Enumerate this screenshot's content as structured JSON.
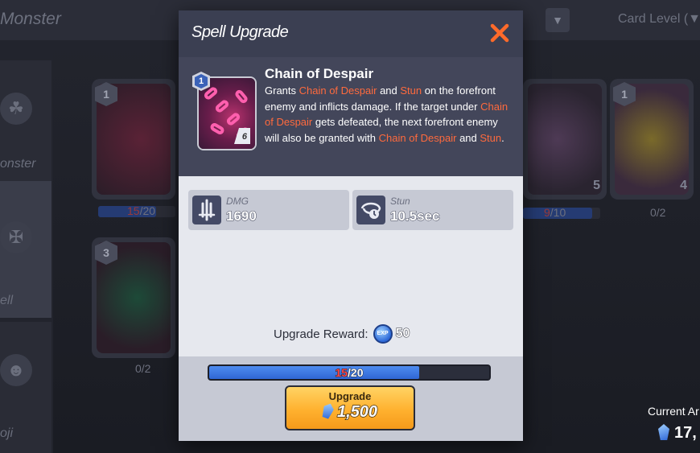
{
  "background": {
    "page_title": "Monster",
    "sort_label": "Card Level (▼",
    "sidebar_tabs": [
      {
        "label": "onster",
        "icon": "monster-icon"
      },
      {
        "label": "ell",
        "icon": "spell-icon"
      },
      {
        "label": "oji",
        "icon": "emoji-icon"
      }
    ],
    "cards": [
      {
        "level": "1",
        "grade": ""
      },
      {
        "level": "3",
        "grade": ""
      },
      {
        "level": "",
        "grade": "5"
      },
      {
        "level": "1",
        "grade": "4"
      }
    ],
    "progress_labels": [
      {
        "current": "15",
        "max": "/20"
      },
      {
        "current": "",
        "max": "0/2"
      },
      {
        "current": "9",
        "max": "/10"
      },
      {
        "current": "",
        "max": "0/2"
      }
    ],
    "currency_label": "Current Ar",
    "currency_amount": "17,"
  },
  "modal": {
    "title": "Spell Upgrade",
    "close_icon": "close-icon",
    "spell": {
      "name": "Chain of Despair",
      "card_level": "1",
      "card_grade": "6",
      "description": [
        {
          "t": "Grants ",
          "h": false
        },
        {
          "t": "Chain of Despair",
          "h": true
        },
        {
          "t": " and ",
          "h": false
        },
        {
          "t": "Stun",
          "h": true
        },
        {
          "t": " on the forefront enemy and inflicts damage. If the target under ",
          "h": false
        },
        {
          "t": "Chain of Despair",
          "h": true
        },
        {
          "t": " gets defeated, the next forefront enemy will also be granted with ",
          "h": false
        },
        {
          "t": "Chain of Despair",
          "h": true
        },
        {
          "t": " and ",
          "h": false
        },
        {
          "t": "Stun",
          "h": true
        },
        {
          "t": ".",
          "h": false
        }
      ]
    },
    "stats": [
      {
        "label": "DMG",
        "value": "1690",
        "icon": "sword-icon"
      },
      {
        "label": "Stun",
        "value": "10.5sec",
        "icon": "stun-icon"
      }
    ],
    "reward": {
      "label": "Upgrade Reward:",
      "icon": "exp-icon",
      "icon_text": "EXP",
      "value": "50"
    },
    "progress": {
      "current": 15,
      "max": 20,
      "current_text": "15",
      "max_text": "/20"
    },
    "upgrade_button": {
      "label": "Upgrade",
      "cost": "1,500",
      "cost_icon": "gem-icon"
    }
  },
  "colors": {
    "highlight": "#ff6a3d",
    "close": "#ff6a2a",
    "button": "#ffb12f",
    "progress_fill": "#3f7ee8"
  }
}
